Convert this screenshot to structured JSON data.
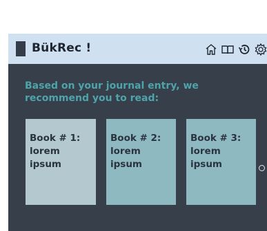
{
  "header": {
    "title": "BükRec !",
    "icons": [
      "home-icon",
      "book-icon",
      "history-icon",
      "settings-icon"
    ]
  },
  "main": {
    "recommend_text": "Based on your journal entry, we recommend you to read:",
    "books": [
      {
        "label": "Book # 1:",
        "title": "lorem ipsum"
      },
      {
        "label": "Book # 2:",
        "title": "lorem ipsum"
      },
      {
        "label": "Book # 3:",
        "title": "lorem ipsum"
      }
    ]
  },
  "colors": {
    "header_bg": "#cfe1f0",
    "main_bg": "#373f4b",
    "accent_teal": "#4ea4ab",
    "card_first": "#b3c9cf",
    "card_other": "#8fb9c0"
  }
}
